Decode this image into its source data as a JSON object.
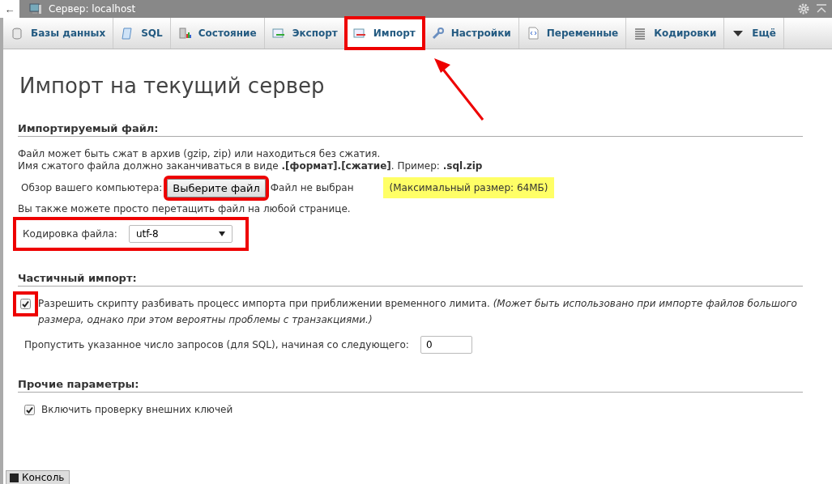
{
  "window": {
    "back": "←",
    "title": "Сервер: localhost"
  },
  "tabs": [
    {
      "label": "Базы данных",
      "selected": false,
      "highlighted": false
    },
    {
      "label": "SQL",
      "selected": false,
      "highlighted": false
    },
    {
      "label": "Состояние",
      "selected": false,
      "highlighted": false
    },
    {
      "label": "Экспорт",
      "selected": false,
      "highlighted": false
    },
    {
      "label": "Импорт",
      "selected": true,
      "highlighted": true
    },
    {
      "label": "Настройки",
      "selected": false,
      "highlighted": false
    },
    {
      "label": "Переменные",
      "selected": false,
      "highlighted": false
    },
    {
      "label": "Кодировки",
      "selected": false,
      "highlighted": false
    },
    {
      "label": "Ещё",
      "selected": false,
      "highlighted": false
    }
  ],
  "page_title": "Импорт на текущий сервер",
  "file_section": {
    "heading": "Импортируемый файл:",
    "note_1": "Файл может быть сжат в архив (gzip, zip) или находиться без сжатия.",
    "note_2": "Имя сжатого файла должно заканчиваться в виде **.[формат].[сжатие]**. Пример: **.sql.zip**",
    "browse_label": "Обзор вашего компьютера:",
    "browse_button": "Выберите файл",
    "browse_highlighted": true,
    "file_status": "Файл не выбран",
    "max_size": "(Максимальный размер: 64МБ)",
    "drag_note": "Вы также можете просто перетащить файл на любой странице.",
    "charset_label": "Кодировка файла:",
    "charset_value": "utf-8",
    "charset_highlighted": true
  },
  "partial_section": {
    "heading": "Частичный импорт:",
    "allow_interrupt": {
      "checked": true,
      "highlighted": true,
      "label": "Разрешить скрипту разбивать процесс импорта при приближении временного лимита. *(Может быть использовано при импорте файлов большого размера, однако при этом вероятны проблемы с транзакциями.)*"
    },
    "skip_label": "Пропустить указанное число запросов (для SQL), начиная со следующего:",
    "skip_value": "0"
  },
  "other_section": {
    "heading": "Прочие параметры:",
    "foreign_keys": {
      "checked": true,
      "label": "Включить проверку внешних ключей"
    }
  },
  "console": "Консоль"
}
